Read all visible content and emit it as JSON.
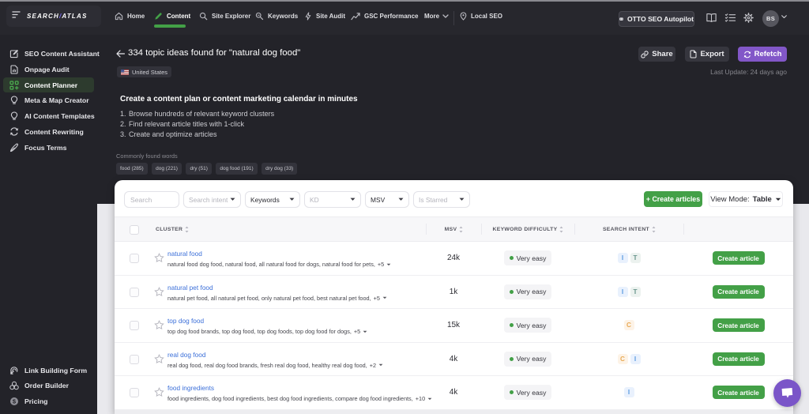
{
  "topbar": {
    "logo_part1": "SEARCH",
    "logo_slash": "/",
    "logo_part2": "ATLAS",
    "nav": {
      "home": "Home",
      "content": "Content",
      "site_explorer": "Site Explorer",
      "keywords": "Keywords",
      "site_audit": "Site Audit",
      "gsc_performance": "GSC Performance",
      "more": "More",
      "local_seo": "Local SEO"
    },
    "otto_label": "OTTO SEO Autopilot",
    "avatar_initials": "BS"
  },
  "sidebar": {
    "items": [
      {
        "label": "SEO Content Assistant"
      },
      {
        "label": "Onpage Audit"
      },
      {
        "label": "Content Planner"
      },
      {
        "label": "Meta & Map Creator"
      },
      {
        "label": "AI Content Templates"
      },
      {
        "label": "Content Rewriting"
      },
      {
        "label": "Focus Terms"
      }
    ],
    "bottom": [
      {
        "label": "Link Building Form"
      },
      {
        "label": "Order Builder"
      },
      {
        "label": "Pricing"
      }
    ]
  },
  "header": {
    "title": "334 topic ideas found for \"natural dog food\"",
    "country": "United States",
    "share_label": "Share",
    "export_label": "Export",
    "refetch_label": "Refetch",
    "last_update": "Last Update: 24 days ago"
  },
  "intro": {
    "heading": "Create a content plan or content marketing calendar in minutes",
    "steps": [
      {
        "num": "1.",
        "text": "Browse hundreds of relevant keyword clusters"
      },
      {
        "num": "2.",
        "text": "Find relevant article titles with 1-click"
      },
      {
        "num": "3.",
        "text": "Create and optimize articles"
      }
    ]
  },
  "common_words": {
    "label": "Commonly found words",
    "chips": [
      {
        "text": "food (285)"
      },
      {
        "text": "dog (221)"
      },
      {
        "text": "dry (51)"
      },
      {
        "text": "dog food (191)"
      },
      {
        "text": "dry dog (33)"
      }
    ]
  },
  "filters": {
    "search_placeholder": "Search",
    "search_intent": "Search intent",
    "keywords": "Keywords",
    "kd": "KD",
    "msv": "MSV",
    "is_starred": "Is Starred",
    "create_articles": "+ Create articles",
    "view_mode_label": "View Mode:",
    "view_mode_value": "Table"
  },
  "table": {
    "col_cluster": "CLUSTER",
    "col_msv": "MSV",
    "col_difficulty": "KEYWORD DIFFICULTY",
    "col_intent": "SEARCH INTENT",
    "action_label": "Create article",
    "rows": [
      {
        "cluster": "natural food",
        "keywords": "natural food dog food, natural food, all natural food for dogs, natural food for pets,",
        "more": "+5",
        "msv": "24k",
        "difficulty": "Very easy",
        "intents": [
          {
            "letter": "I",
            "type": "i"
          },
          {
            "letter": "T",
            "type": "t"
          }
        ]
      },
      {
        "cluster": "natural pet food",
        "keywords": "natural pet food, all natural pet food, only natural pet food, best natural pet food,",
        "more": "+5",
        "msv": "1k",
        "difficulty": "Very easy",
        "intents": [
          {
            "letter": "I",
            "type": "i"
          },
          {
            "letter": "T",
            "type": "t"
          }
        ]
      },
      {
        "cluster": "top dog food",
        "keywords": "top dog food brands, top dog food, top dog foods, top dog food for dogs,",
        "more": "+5",
        "msv": "15k",
        "difficulty": "Very easy",
        "intents": [
          {
            "letter": "C",
            "type": "c"
          }
        ]
      },
      {
        "cluster": "real dog food",
        "keywords": "real dog food, real dog food brands, fresh real dog food, healthy real dog food,",
        "more": "+2",
        "msv": "4k",
        "difficulty": "Very easy",
        "intents": [
          {
            "letter": "C",
            "type": "c"
          },
          {
            "letter": "I",
            "type": "i"
          }
        ]
      },
      {
        "cluster": "food ingredients",
        "keywords": "food ingredients, dog food ingredients, best dog food ingredients, compare dog food ingredients,",
        "more": "+10",
        "msv": "4k",
        "difficulty": "Very easy",
        "intents": [
          {
            "letter": "I",
            "type": "i"
          }
        ]
      }
    ]
  },
  "colors": {
    "accent_green": "#43a047",
    "purple": "#8257c8",
    "link_blue": "#3b6fd9"
  }
}
